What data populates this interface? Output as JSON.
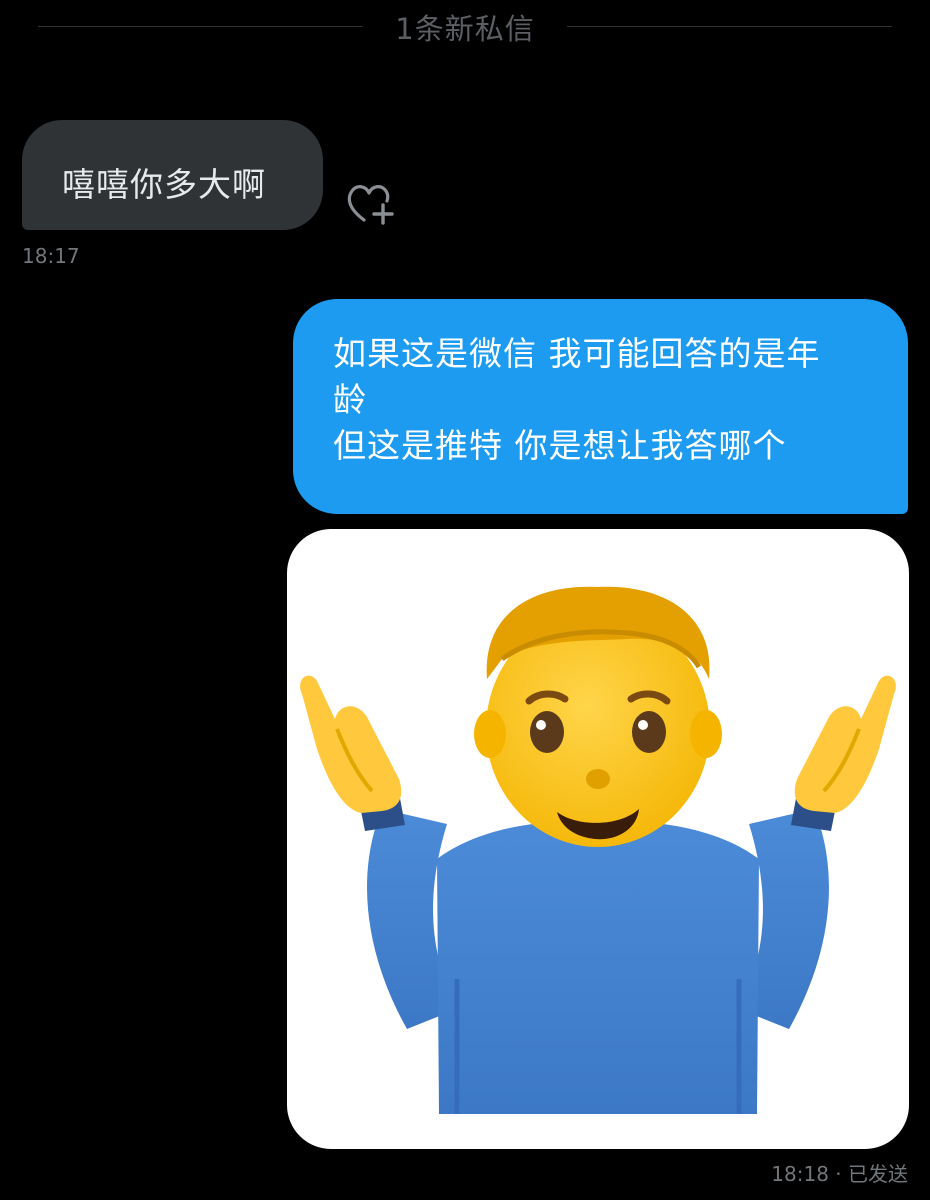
{
  "divider": {
    "label": "1条新私信"
  },
  "incoming": {
    "text": "嘻嘻你多大啊",
    "time": "18:17"
  },
  "outgoing": {
    "lines": [
      "如果这是微信 我可能回答的是年",
      "龄",
      "但这是推特 你是想让我答哪个"
    ],
    "time": "18:18",
    "separator": "·",
    "status": "已发送"
  },
  "media": {
    "subject": "man-shrugging-emoji"
  },
  "colors": {
    "background": "#000000",
    "incoming_bubble": "#2f3336",
    "outgoing_bubble": "#1d9bf0",
    "muted_text": "#71767b"
  }
}
